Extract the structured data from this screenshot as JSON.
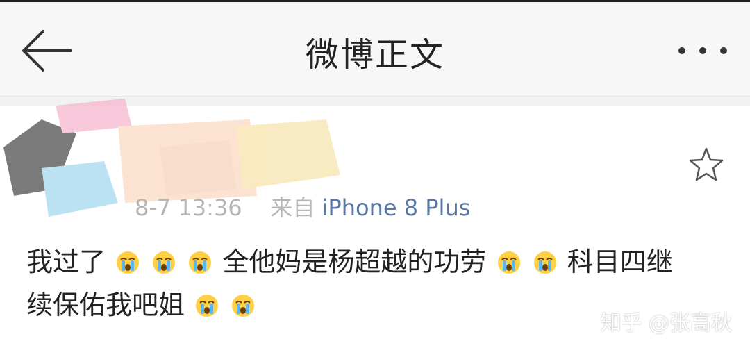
{
  "header": {
    "title": "微博正文",
    "back_icon": "arrow-left-icon",
    "more_icon": "more-dots-icon"
  },
  "post": {
    "time": "8-7 13:36",
    "source_prefix": "来自",
    "source_device": "iPhone 8 Plus",
    "body_segments": [
      "我过了",
      "全他妈是杨超越的功劳",
      "科目四继",
      "续保佑我吧姐"
    ],
    "emoji_name": "crying-face-emoji",
    "favorite_icon": "star-outline-icon"
  },
  "watermark": "知乎 @张高秋",
  "colors": {
    "topbar_bg": "#f7f7f7",
    "link_blue": "#5a78a6",
    "meta_gray": "#b6b6b6",
    "text": "#222222"
  }
}
